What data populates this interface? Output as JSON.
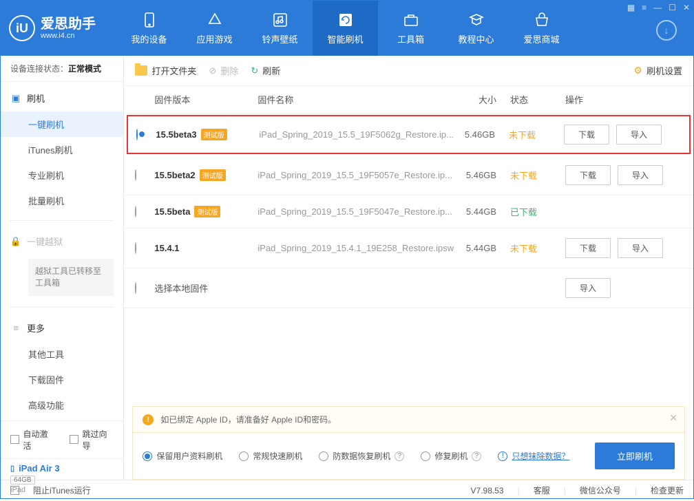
{
  "app": {
    "name": "爱思助手",
    "url": "www.i4.cn"
  },
  "tabs": [
    {
      "label": "我的设备"
    },
    {
      "label": "应用游戏"
    },
    {
      "label": "铃声壁纸"
    },
    {
      "label": "智能刷机"
    },
    {
      "label": "工具箱"
    },
    {
      "label": "教程中心"
    },
    {
      "label": "爱思商城"
    }
  ],
  "conn": {
    "label": "设备连接状态：",
    "value": "正常模式"
  },
  "sidebar": {
    "flash_head": "刷机",
    "items": [
      "一键刷机",
      "iTunes刷机",
      "专业刷机",
      "批量刷机"
    ],
    "jailbreak_head": "一键越狱",
    "jailbreak_note": "越狱工具已转移至工具箱",
    "more_head": "更多",
    "more_items": [
      "其他工具",
      "下载固件",
      "高级功能"
    ]
  },
  "auto": {
    "activate": "自动激活",
    "skip": "跳过向导"
  },
  "device": {
    "name": "iPad Air 3",
    "capacity": "64GB",
    "type": "iPad"
  },
  "toolbar": {
    "open": "打开文件夹",
    "delete": "删除",
    "refresh": "刷新",
    "settings": "刷机设置"
  },
  "thead": {
    "version": "固件版本",
    "name": "固件名称",
    "size": "大小",
    "status": "状态",
    "action": "操作"
  },
  "status": {
    "not": "未下载",
    "done": "已下载"
  },
  "btn": {
    "download": "下载",
    "import": "导入"
  },
  "tag": "测试版",
  "rows": [
    {
      "ver": "15.5beta3",
      "tag": true,
      "name": "iPad_Spring_2019_15.5_19F5062g_Restore.ip...",
      "size": "5.46GB",
      "status": "not",
      "selected": true,
      "dl": true,
      "imp": true
    },
    {
      "ver": "15.5beta2",
      "tag": true,
      "name": "iPad_Spring_2019_15.5_19F5057e_Restore.ip...",
      "size": "5.46GB",
      "status": "not",
      "dl": true,
      "imp": true
    },
    {
      "ver": "15.5beta",
      "tag": true,
      "name": "iPad_Spring_2019_15.5_19F5047e_Restore.ip...",
      "size": "5.44GB",
      "status": "done"
    },
    {
      "ver": "15.4.1",
      "tag": false,
      "name": "iPad_Spring_2019_15.4.1_19E258_Restore.ipsw",
      "size": "5.44GB",
      "status": "not",
      "dl": true,
      "imp": true
    },
    {
      "ver": "选择本地固件",
      "local": true,
      "imp": true
    }
  ],
  "notice": "如已绑定 Apple ID，请准备好 Apple ID和密码。",
  "modes": {
    "keep": "保留用户资料刷机",
    "normal": "常规快速刷机",
    "recover": "防数据恢复刷机",
    "repair": "修复刷机",
    "erase_link": "只想抹除数据？"
  },
  "primary": "立即刷机",
  "footer": {
    "block_itunes": "阻止iTunes运行",
    "version": "V7.98.53",
    "service": "客服",
    "wechat": "微信公众号",
    "update": "检查更新"
  }
}
